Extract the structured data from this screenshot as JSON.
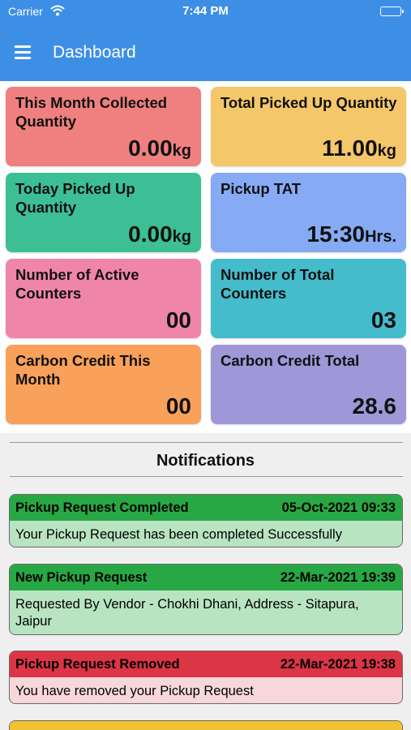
{
  "status_bar": {
    "carrier": "Carrier",
    "time": "7:44 PM"
  },
  "app_bar": {
    "title": "Dashboard"
  },
  "tiles": [
    {
      "label": "This Month Collected Quantity",
      "value": "0.00",
      "unit": "kg",
      "color": "#f08080"
    },
    {
      "label": "Total Picked Up Quantity",
      "value": "11.00",
      "unit": "kg",
      "color": "#f4c76b"
    },
    {
      "label": "Today Picked Up Quantity",
      "value": "0.00",
      "unit": "kg",
      "color": "#3dbf96"
    },
    {
      "label": "Pickup TAT",
      "value": "15:30",
      "unit": "Hrs.",
      "color": "#86aaf4"
    },
    {
      "label": "Number of Active Counters",
      "value": "00",
      "unit": "",
      "color": "#ef86a9"
    },
    {
      "label": "Number of Total Counters",
      "value": "03",
      "unit": "",
      "color": "#45bccb"
    },
    {
      "label": "Carbon Credit This Month",
      "value": "00",
      "unit": "",
      "color": "#f9a15a"
    },
    {
      "label": "Carbon Credit Total",
      "value": "28.6",
      "unit": "",
      "color": "#9e98d8"
    }
  ],
  "notifications": {
    "title": "Notifications",
    "items": [
      {
        "title": "Pickup Request Completed",
        "datetime": "05-Oct-2021 09:33",
        "message": "Your Pickup Request has been completed Successfully",
        "header_color": "#27a844",
        "body_color": "#b8e4c2"
      },
      {
        "title": "New Pickup Request",
        "datetime": "22-Mar-2021 19:39",
        "message": "Requested By Vendor - Chokhi Dhani, Address - Sitapura, Jaipur",
        "header_color": "#27a844",
        "body_color": "#b8e4c2"
      },
      {
        "title": "Pickup Request Removed",
        "datetime": "22-Mar-2021 19:38",
        "message": "You have removed your Pickup Request",
        "header_color": "#dc3545",
        "body_color": "#f8d7da"
      },
      {
        "title": "",
        "datetime": "",
        "message": "",
        "header_color": "#f2c230",
        "body_color": "#fff2c2"
      }
    ]
  }
}
